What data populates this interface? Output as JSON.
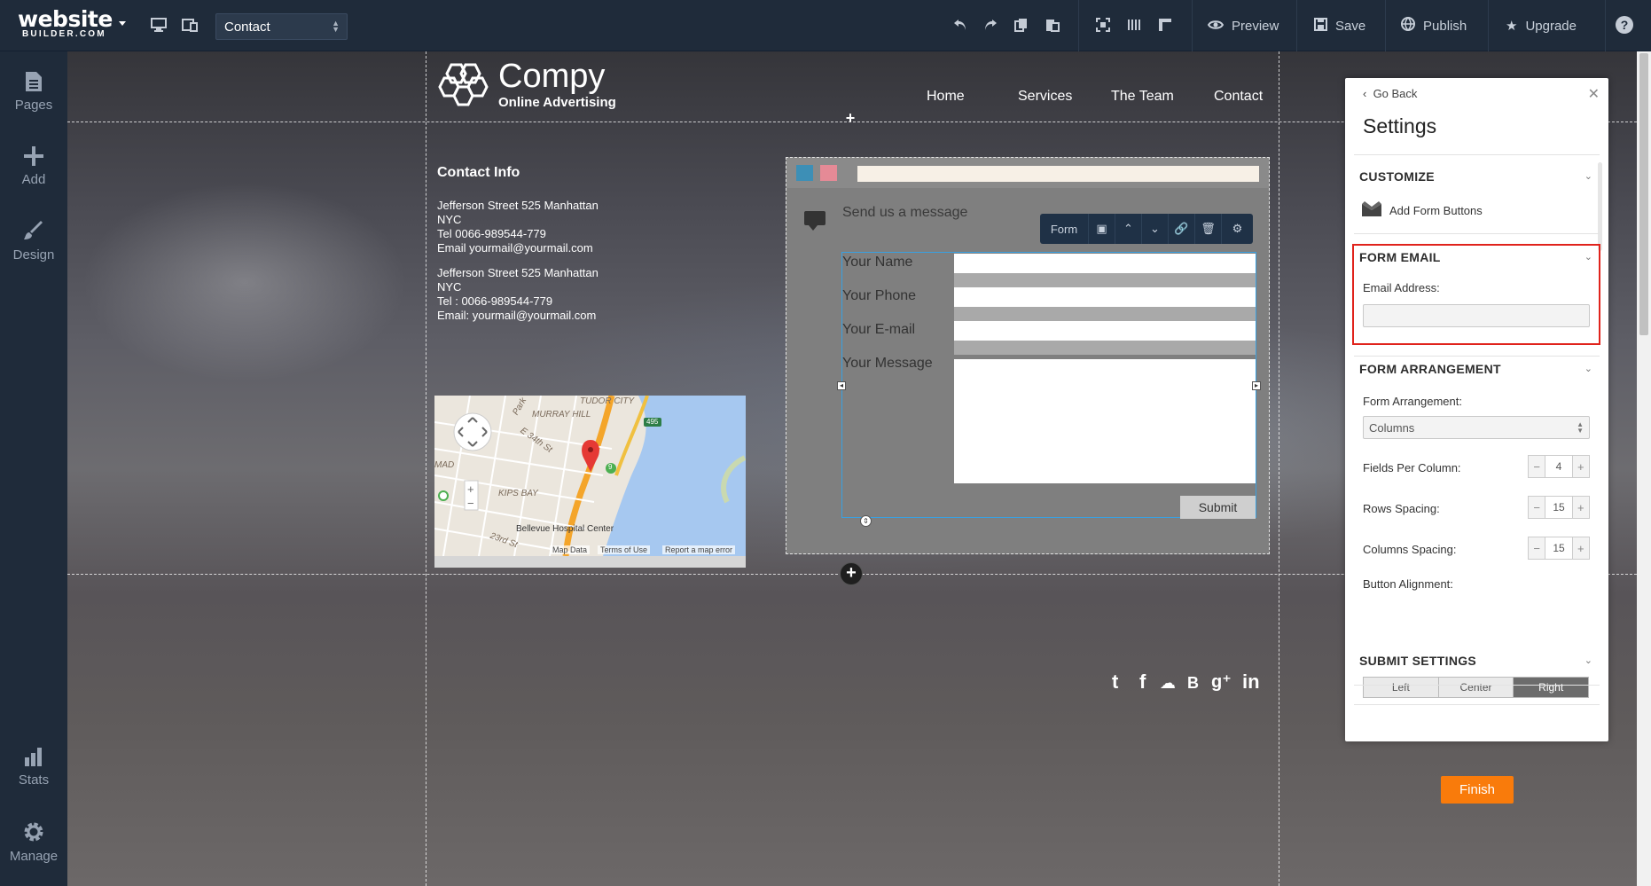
{
  "topbar": {
    "logo_main": "website",
    "logo_sub": "BUILDER.COM",
    "page_select_value": "Contact",
    "preview_label": "Preview",
    "save_label": "Save",
    "publish_label": "Publish",
    "upgrade_label": "Upgrade",
    "help_label": "?"
  },
  "sidebar": {
    "items": [
      {
        "label": "Pages",
        "icon": "pages-icon"
      },
      {
        "label": "Add",
        "icon": "plus-icon"
      },
      {
        "label": "Design",
        "icon": "brush-icon"
      },
      {
        "label": "Stats",
        "icon": "bar-chart-icon"
      },
      {
        "label": "Manage",
        "icon": "gear-icon"
      }
    ]
  },
  "site": {
    "brand_name": "Compy",
    "brand_tagline": "Online Advertising",
    "nav": [
      "Home",
      "Services",
      "The Team",
      "Contact"
    ],
    "contact_title": "Contact Info",
    "contact_lines": [
      "Jefferson Street 525 Manhattan",
      "NYC",
      "Tel 0066-989544-779",
      "Email yourmail@yourmail.com",
      "Jefferson Street 525 Manhattan",
      "NYC",
      "Tel : 0066-989544-779",
      "Email: yourmail@yourmail.com"
    ],
    "map": {
      "labels": [
        "TUDOR CITY",
        "MURRAY HILL",
        "E 34th St",
        "Park",
        "KIPS BAY",
        "Bellevue Hospital Center",
        "MAD",
        "23rd St",
        "495",
        "9"
      ],
      "footer": [
        "Map Data",
        "Terms of Use",
        "Report a map error"
      ],
      "zoom_in": "+",
      "zoom_out": "−"
    },
    "form": {
      "title": "Send us a message",
      "toolbar_label": "Form",
      "fields": [
        "Your Name",
        "Your Phone",
        "Your E-mail",
        "Your Message"
      ],
      "submit_label": "Submit",
      "swatch_colors": [
        "#3d8fb6",
        "#e58a96"
      ]
    }
  },
  "settings": {
    "go_back": "Go Back",
    "title": "Settings",
    "customize_title": "CUSTOMIZE",
    "add_form_buttons": "Add Form Buttons",
    "form_email_title": "FORM EMAIL",
    "email_address_label": "Email Address:",
    "email_address_value": "",
    "form_arrangement_title": "FORM ARRANGEMENT",
    "form_arrangement_label": "Form Arrangement:",
    "form_arrangement_value": "Columns",
    "fields_per_column_label": "Fields Per Column:",
    "fields_per_column_value": "4",
    "rows_spacing_label": "Rows Spacing:",
    "rows_spacing_value": "15",
    "columns_spacing_label": "Columns Spacing:",
    "columns_spacing_value": "15",
    "button_alignment_label": "Button Alignment:",
    "alignment_options": [
      "Left",
      "Center",
      "Right"
    ],
    "alignment_selected": "Right",
    "submit_settings_title": "SUBMIT SETTINGS",
    "finish_label": "Finish",
    "accent_color": "#f97b0b",
    "highlight_color": "#e0231c"
  }
}
